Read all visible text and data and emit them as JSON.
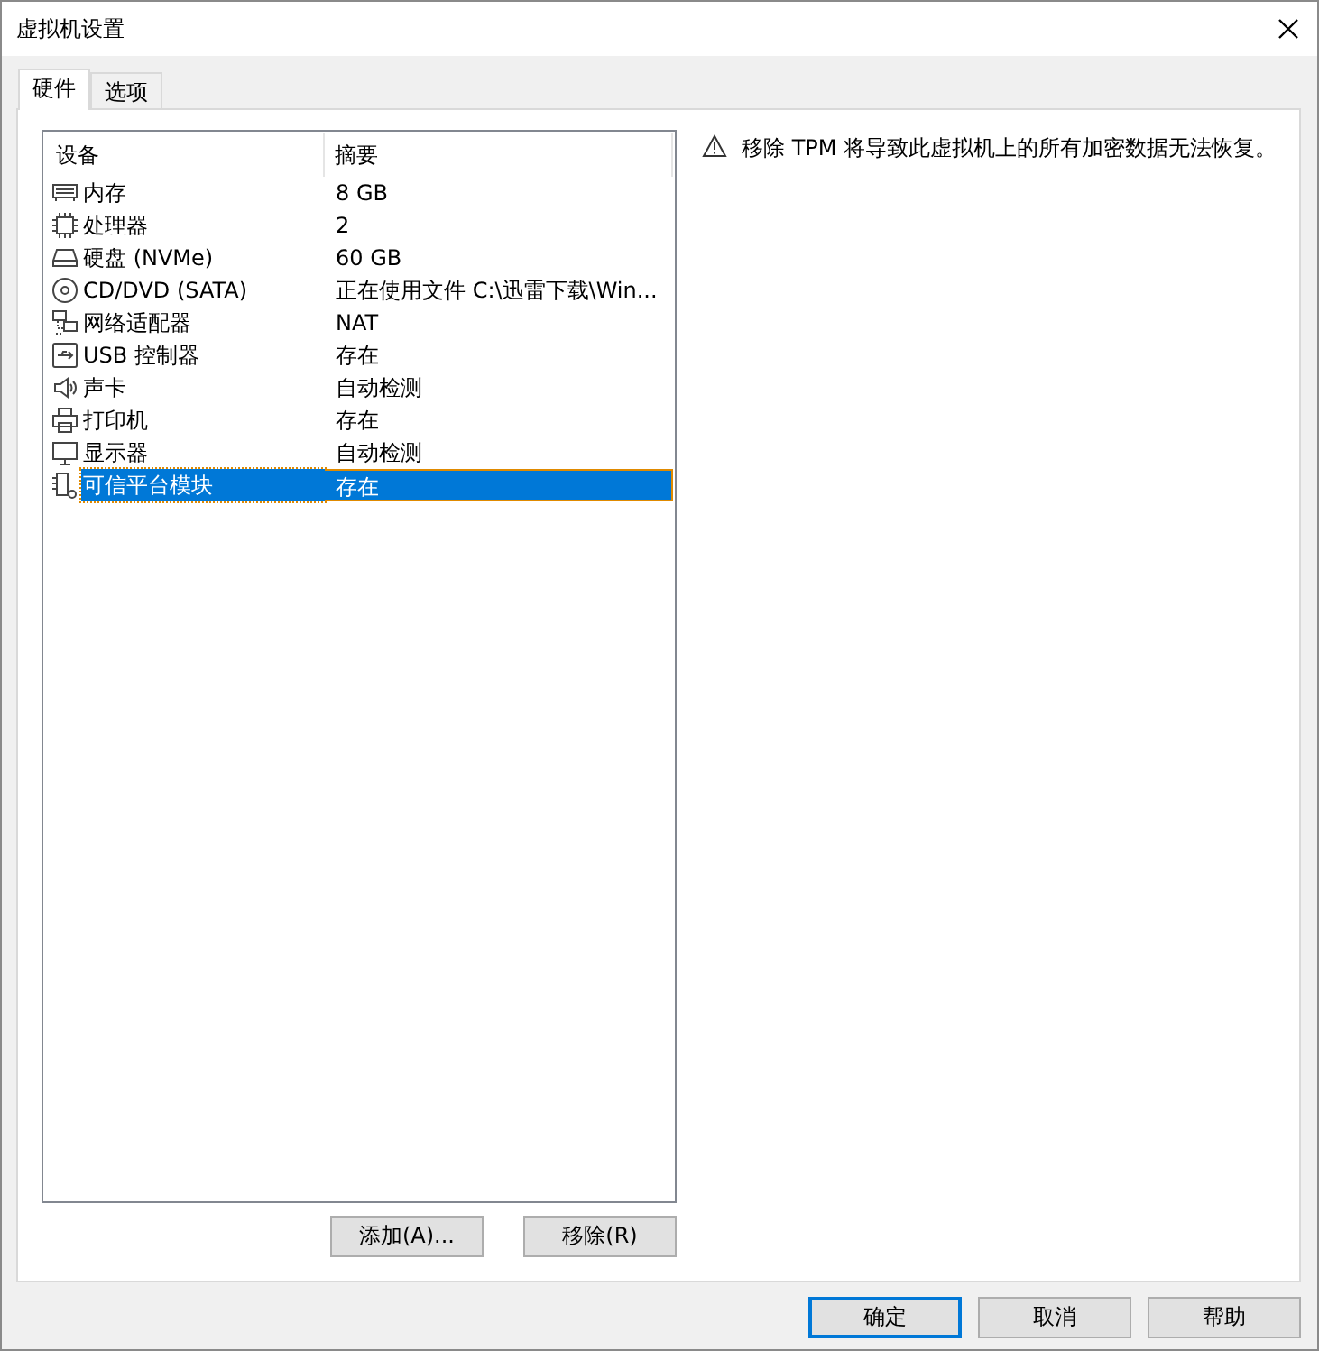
{
  "window": {
    "title": "虚拟机设置"
  },
  "tabs": [
    {
      "label": "硬件",
      "selected": true
    },
    {
      "label": "选项",
      "selected": false
    }
  ],
  "table": {
    "columns": [
      "设备",
      "摘要"
    ],
    "rows": [
      {
        "kind": "memory",
        "device": "内存",
        "summary": "8 GB",
        "selected": false
      },
      {
        "kind": "cpu",
        "device": "处理器",
        "summary": "2",
        "selected": false
      },
      {
        "kind": "disk",
        "device": "硬盘 (NVMe)",
        "summary": "60 GB",
        "selected": false
      },
      {
        "kind": "cd",
        "device": "CD/DVD (SATA)",
        "summary": "正在使用文件 C:\\迅雷下载\\Win...",
        "selected": false
      },
      {
        "kind": "network",
        "device": "网络适配器",
        "summary": "NAT",
        "selected": false
      },
      {
        "kind": "usb",
        "device": "USB 控制器",
        "summary": "存在",
        "selected": false
      },
      {
        "kind": "sound",
        "device": "声卡",
        "summary": "自动检测",
        "selected": false
      },
      {
        "kind": "printer",
        "device": "打印机",
        "summary": "存在",
        "selected": false
      },
      {
        "kind": "display",
        "device": "显示器",
        "summary": "自动检测",
        "selected": false
      },
      {
        "kind": "tpm",
        "device": "可信平台模块",
        "summary": "存在",
        "selected": true
      }
    ]
  },
  "list_buttons": [
    "添加(A)...",
    "移除(R)"
  ],
  "warning": "移除 TPM 将导致此虚拟机上的所有加密数据无法恢复。",
  "buttons": [
    {
      "label": "确定",
      "default": true
    },
    {
      "label": "取消",
      "default": false
    },
    {
      "label": "帮助",
      "default": false
    }
  ]
}
